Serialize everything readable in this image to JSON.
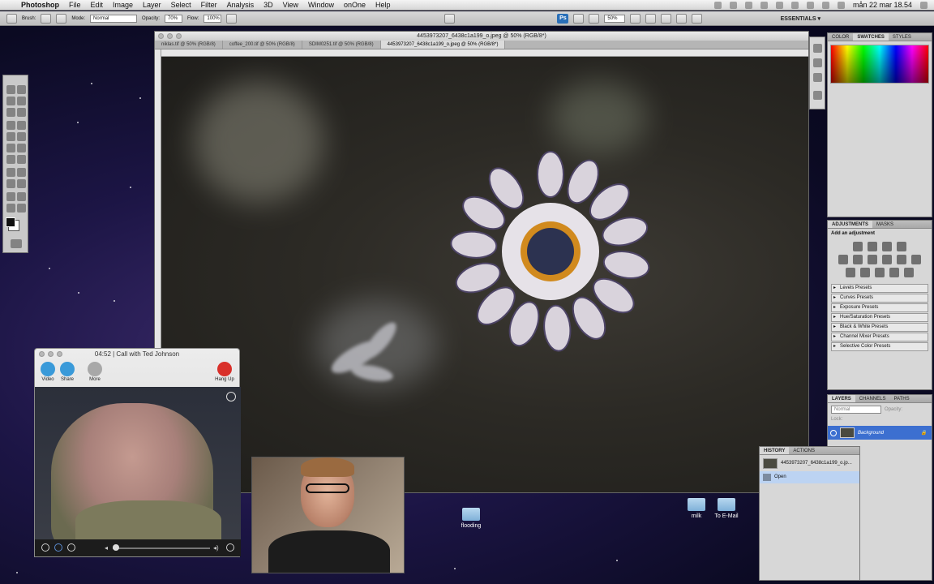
{
  "menubar": {
    "app": "Photoshop",
    "menus": [
      "File",
      "Edit",
      "Image",
      "Layer",
      "Select",
      "Filter",
      "Analysis",
      "3D",
      "View",
      "Window",
      "onOne",
      "Help"
    ],
    "clock": "mån 22 mar  18.54"
  },
  "options": {
    "brush_label": "Brush:",
    "mode_label": "Mode:",
    "mode_value": "Normal",
    "opacity_label": "Opacity:",
    "opacity_value": "70%",
    "flow_label": "Flow:",
    "flow_value": "100%",
    "zoom": "50%",
    "workspace": "ESSENTIALS ▾"
  },
  "document": {
    "title": "4453973207_6438c1a199_o.jpeg @ 50% (RGB/8*)",
    "tabs": [
      "niklas.tif @ 50% (RGB/8)",
      "coffee_200.tif @ 50% (RGB/8)",
      "SDIM0251.tif @ 50% (RGB/8)",
      "4453973207_6438c1a199_o.jpeg @ 50% (RGB/8*)"
    ]
  },
  "swatches_panel": {
    "tabs": [
      "COLOR",
      "SWATCHES",
      "STYLES"
    ]
  },
  "adjustments_panel": {
    "tabs": [
      "ADJUSTMENTS",
      "MASKS"
    ],
    "heading": "Add an adjustment",
    "presets": [
      "Levels Presets",
      "Curves Presets",
      "Exposure Presets",
      "Hue/Saturation Presets",
      "Black & White Presets",
      "Channel Mixer Presets",
      "Selective Color Presets"
    ]
  },
  "layers_panel": {
    "tabs": [
      "LAYERS",
      "CHANNELS",
      "PATHS"
    ],
    "blend_mode": "Normal",
    "opacity_label": "Opacity:",
    "lock_label": "Lock:",
    "layer_name": "Background"
  },
  "history_panel": {
    "tabs": [
      "HISTORY",
      "ACTIONS"
    ],
    "snapshot": "4453973207_6438c1a199_o.jp...",
    "step": "Open"
  },
  "facetime": {
    "title": "04:52 | Call with Ted Johnson",
    "buttons": {
      "video": "Video",
      "share": "Share",
      "more": "More",
      "hangup": "Hang Up"
    }
  },
  "desktop": {
    "folders": [
      "flooding",
      "milk",
      "To E-Mail"
    ]
  },
  "colors": {
    "hangup": "#d9302a",
    "video_btn": "#3a9ad9",
    "ps_blue": "#2a6fb8"
  }
}
